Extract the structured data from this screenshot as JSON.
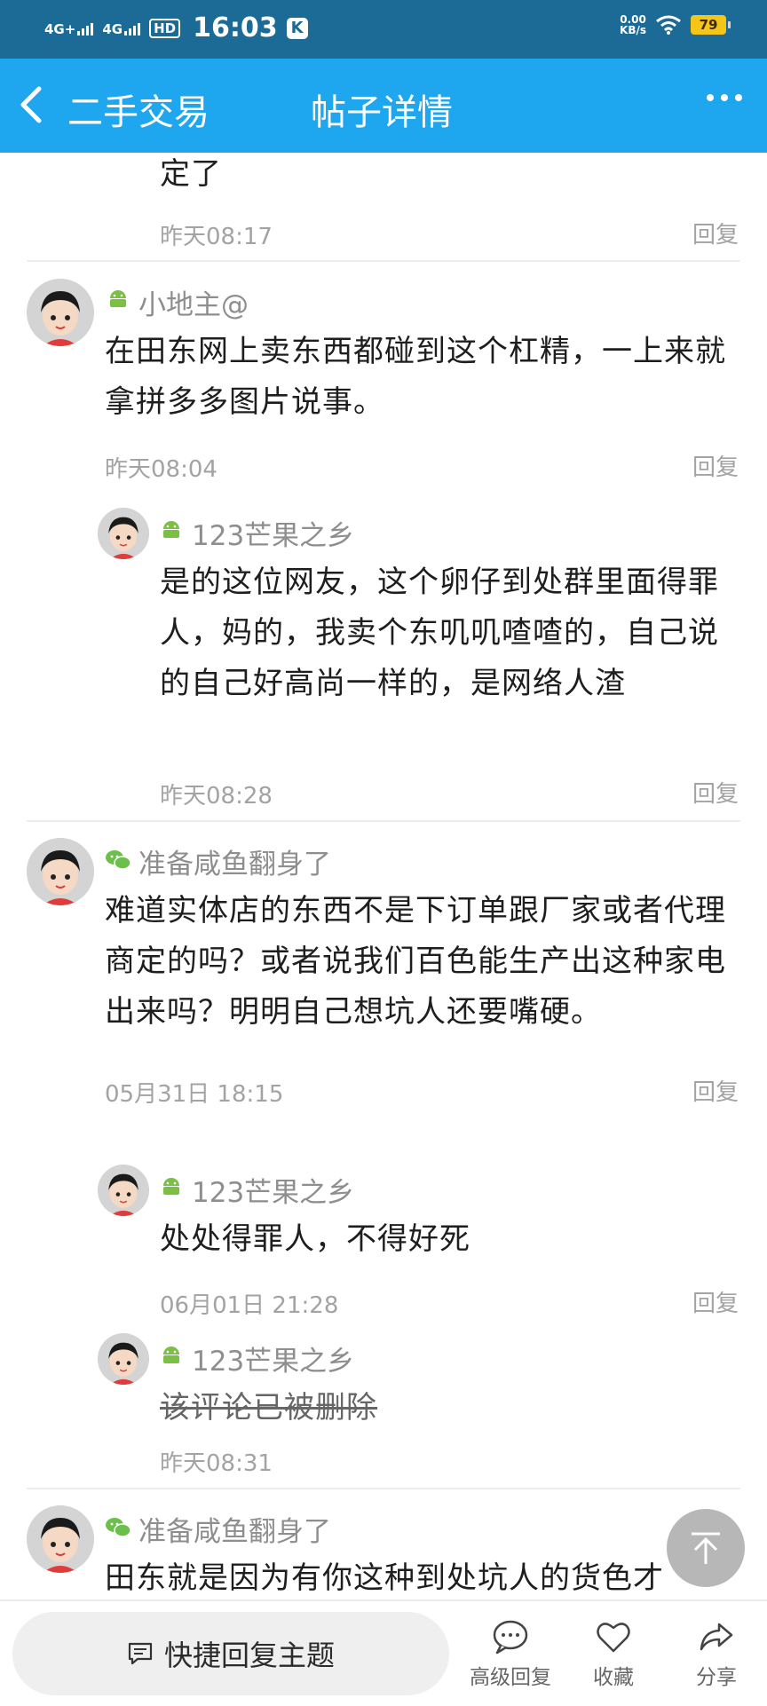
{
  "status_bar": {
    "signal1": "4G+",
    "signal2": "4G",
    "hd": "HD",
    "time": "16:03",
    "k_icon": "K",
    "net_value": "0.00",
    "net_unit": "KB/s",
    "battery": "79"
  },
  "header": {
    "back_label": "二手交易",
    "title": "帖子详情"
  },
  "comments": {
    "c0": {
      "text_tail": "定了",
      "time": "昨天08:17",
      "reply": "回复"
    },
    "c1": {
      "name": "小地主@",
      "platform_icon": "android-icon",
      "text": "在田东网上卖东西都碰到这个杠精，一上来就拿拼多多图片说事。",
      "time": "昨天08:04",
      "reply": "回复",
      "sub1": {
        "name": "123芒果之乡",
        "platform_icon": "android-icon",
        "text": "是的这位网友，这个卵仔到处群里面得罪人，妈的，我卖个东叽叽喳喳的，自己说的自己好高尚一样的，是网络人渣",
        "time": "昨天08:28",
        "reply": "回复"
      }
    },
    "c2": {
      "name": "准备咸鱼翻身了",
      "platform_icon": "wechat-icon",
      "text": "难道实体店的东西不是下订单跟厂家或者代理商定的吗？或者说我们百色能生产出这种家电出来吗？明明自己想坑人还要嘴硬。",
      "time": "05月31日 18:15",
      "reply": "回复",
      "sub1": {
        "name": "123芒果之乡",
        "platform_icon": "android-icon",
        "text": "处处得罪人，不得好死",
        "time": "06月01日 21:28",
        "reply": "回复"
      },
      "sub2": {
        "name": "123芒果之乡",
        "platform_icon": "android-icon",
        "text": "该评论已被删除",
        "time": "昨天08:31"
      }
    },
    "c3": {
      "name": "准备咸鱼翻身了",
      "platform_icon": "wechat-icon",
      "text": "田东就是因为有你这种到处坑人的货色才"
    }
  },
  "bottom_bar": {
    "quick_reply": "快捷回复主题",
    "advanced_reply": "高级回复",
    "favorite": "收藏",
    "share": "分享"
  },
  "colors": {
    "status_bar": "#1b6b96",
    "title_bar": "#1ea7ef",
    "android_green": "#7ac143",
    "wechat_green": "#6bc04b"
  }
}
